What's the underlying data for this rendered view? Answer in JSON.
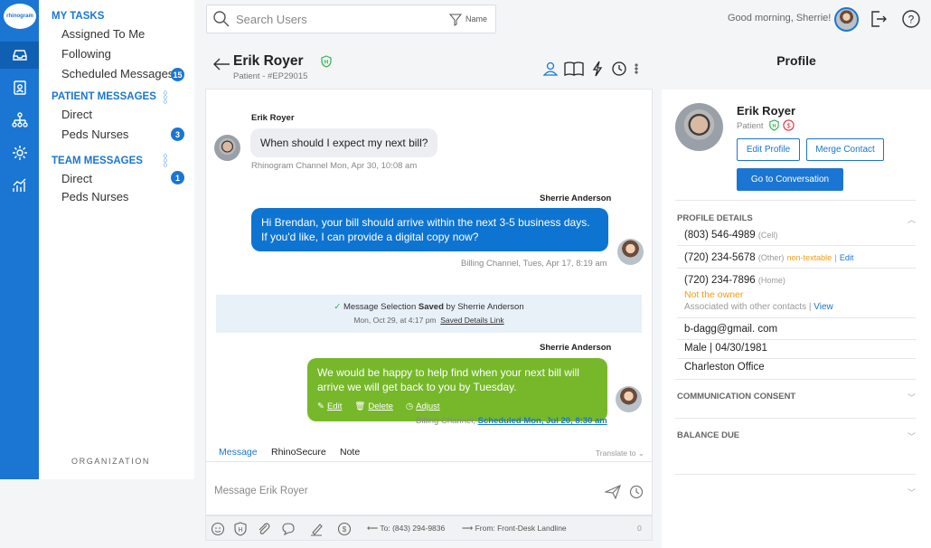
{
  "brand": {
    "logo_text": "rhinogram",
    "accent": "#1a76d2",
    "scheduled_green": "#76b82a",
    "warning_orange": "#f39c12"
  },
  "nav_rail": {
    "items": [
      "inbox-icon",
      "contacts-icon",
      "org-chart-icon",
      "settings-icon",
      "analytics-icon"
    ]
  },
  "sidebar": {
    "my_tasks": "MY TASKS",
    "assigned": "Assigned To Me",
    "following": "Following",
    "scheduled": "Scheduled Messages",
    "scheduled_count": "15",
    "patient_messages": "PATIENT MESSAGES",
    "pm_direct": "Direct",
    "pm_peds": "Peds Nurses",
    "pm_peds_count": "3",
    "team_messages": "TEAM MESSAGES",
    "tm_direct": "Direct",
    "tm_direct_count": "1",
    "tm_peds": "Peds Nurses",
    "organization": "ORGANIZATION"
  },
  "topbar": {
    "search_placeholder": "Search Users",
    "filter_label": "Name",
    "greeting": "Good morning, Sherrie!"
  },
  "conversation": {
    "name": "Erik Royer",
    "patient_id": "Patient - #EP29015",
    "messages": [
      {
        "sender": "Erik Royer",
        "text": "When should I expect my next bill?",
        "meta": "Rhinogram Channel Mon, Apr 30, 10:08 am"
      },
      {
        "sender": "Sherrie Anderson",
        "text": "Hi Brendan, your bill should arrive within the next 3-5 business days. If you'd like, I can provide a digital copy now?",
        "meta": "Billing Channel, Tues, Apr 17, 8:19 am"
      },
      {
        "sender": "Sherrie Anderson",
        "text": "We would be happy to help find when your next bill will arrive we will get back to you by Tuesday.",
        "edit": "Edit",
        "delete": "Delete",
        "adjust": "Adjust",
        "meta_prefix": "Billing Channel,",
        "meta_link": "Scheduled Mon, Jul 20, 8:30 am"
      }
    ],
    "system_note": {
      "prefix": "Message Selection",
      "bold": "Saved",
      "suffix": "by Sherrie Anderson",
      "date": "Mon, Oct 29, at 4:17 pm",
      "link": "Saved Details Link"
    },
    "compose": {
      "tab_message": "Message",
      "tab_rhinosecure": "RhinoSecure",
      "tab_note": "Note",
      "translate": "Translate to",
      "placeholder": "Message Erik Royer",
      "to": "To: (843) 294-9836",
      "from": "From: Front-Desk Landline",
      "char_count": "0"
    }
  },
  "profile": {
    "title": "Profile",
    "name": "Erik Royer",
    "role": "Patient",
    "edit_btn": "Edit Profile",
    "merge_btn": "Merge Contact",
    "goto_btn": "Go to Conversation",
    "details_header": "PROFILE DETAILS",
    "phone1": "(803) 546-4989",
    "phone1_type": "(Cell)",
    "phone2": "(720) 234-5678",
    "phone2_type": "(Other)",
    "non_textable": "non-textable",
    "edit_link": "Edit",
    "phone3": "(720) 234-7896",
    "phone3_type": "(Home)",
    "not_owner": "Not the owner",
    "assoc": "Associated with other contacts |",
    "view": "View",
    "email": "b-dagg@gmail. com",
    "demo": "Male  |  04/30/1981",
    "office": "Charleston Office",
    "consent_header": "COMMUNICATION CONSENT",
    "balance_header": "BALANCE DUE"
  }
}
